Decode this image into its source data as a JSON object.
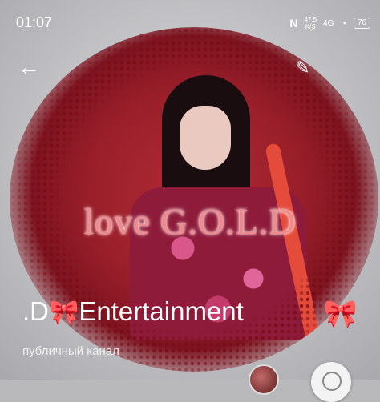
{
  "status_bar": {
    "time": "01:07",
    "net_speed_value": "47,5",
    "net_speed_unit": "K/S",
    "network": "4G",
    "battery": "76"
  },
  "header": {
    "back_icon": "arrow-left-icon",
    "edit_icon": "pencil-icon"
  },
  "cover": {
    "overlay_text": "love G.O.L.D"
  },
  "channel": {
    "name_prefix": ".D",
    "name_bow": "🎀",
    "name_suffix": "Entertainment",
    "bow_right": "🎀",
    "type": "публичный канал"
  },
  "colors": {
    "overlay_text": "#f08a8d",
    "photo_bg": "#9a1f2a"
  }
}
